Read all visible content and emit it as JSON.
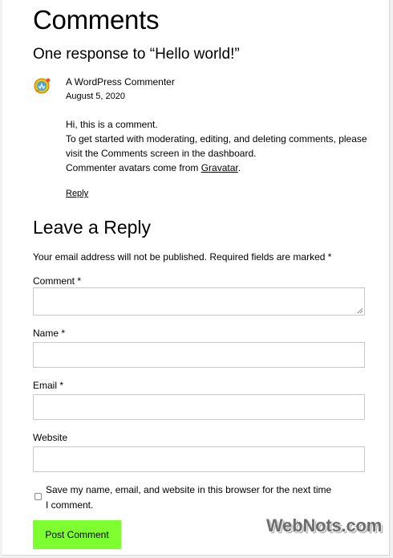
{
  "comments_section": {
    "title": "Comments",
    "response_heading": "One response to “Hello world!”"
  },
  "comment": {
    "author": "A WordPress Commenter",
    "date": "August 5, 2020",
    "lines": [
      "Hi, this is a comment.",
      "To get started with moderating, editing, and deleting comments, please",
      "visit the Comments screen in the dashboard."
    ],
    "avatar_line_prefix": "Commenter avatars come from ",
    "avatar_link": "Gravatar",
    "avatar_line_suffix": ".",
    "reply_label": "Reply"
  },
  "reply_form": {
    "title": "Leave a Reply",
    "notes": "Your email address will not be published. Required fields are marked *",
    "comment_label": "Comment *",
    "comment_value": "",
    "name_label": "Name *",
    "name_value": "",
    "email_label": "Email *",
    "email_value": "",
    "website_label": "Website",
    "website_value": "",
    "cookies_label": "Save my name, email, and website in this browser for the next time I comment.",
    "cookies_checked": false,
    "submit_label": "Post Comment",
    "submit_color": "#7eff2f"
  },
  "watermark": {
    "text": "WebNots.com"
  }
}
